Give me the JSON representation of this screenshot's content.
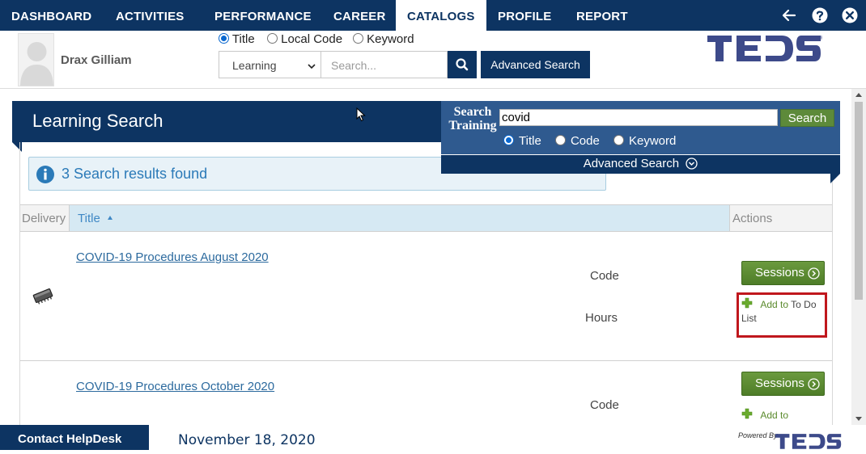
{
  "nav": {
    "items": [
      "DASHBOARD",
      "ACTIVITIES",
      "PERFORMANCE",
      "CAREER",
      "CATALOGS",
      "PROFILE",
      "REPORT"
    ],
    "active": "CATALOGS",
    "icons": [
      "back-arrow-icon",
      "help-icon",
      "close-icon"
    ]
  },
  "user": {
    "name": "Drax Gilliam"
  },
  "top_search": {
    "options": [
      "Title",
      "Local Code",
      "Keyword"
    ],
    "selected_option": "Title",
    "category_value": "Learning",
    "placeholder": "Search...",
    "advanced_label": "Advanced Search"
  },
  "brand": {
    "logo_text": "TEDS",
    "powered_by": "Powered By",
    "color": "#0d3462"
  },
  "learning_search": {
    "title": "Learning Search",
    "panel_label": "Search Training",
    "query": "covid",
    "search_button": "Search",
    "options": [
      "Title",
      "Code",
      "Keyword"
    ],
    "selected_option": "Title",
    "advanced_label": "Advanced Search"
  },
  "results": {
    "summary": "3 Search results found",
    "columns": {
      "delivery": "Delivery",
      "title": "Title",
      "actions": "Actions"
    },
    "rows": [
      {
        "title": "COVID-19 Procedures August 2020",
        "code_label": "Code",
        "hours_label": "Hours",
        "sessions_label": "Sessions",
        "add_label": "Add to",
        "todo_label": "To Do",
        "list_label": "List"
      },
      {
        "title": "COVID-19 Procedures October 2020",
        "code_label": "Code",
        "sessions_label": "Sessions",
        "add_label": "Add to"
      }
    ]
  },
  "footer": {
    "helpdesk": "Contact HelpDesk",
    "date": "November 18, 2020"
  },
  "colors": {
    "navy": "#0d3462",
    "panel_blue": "#2f5a8f",
    "green": "#5d8a3a",
    "link": "#2c6a9e",
    "highlight": "#c0171d"
  }
}
